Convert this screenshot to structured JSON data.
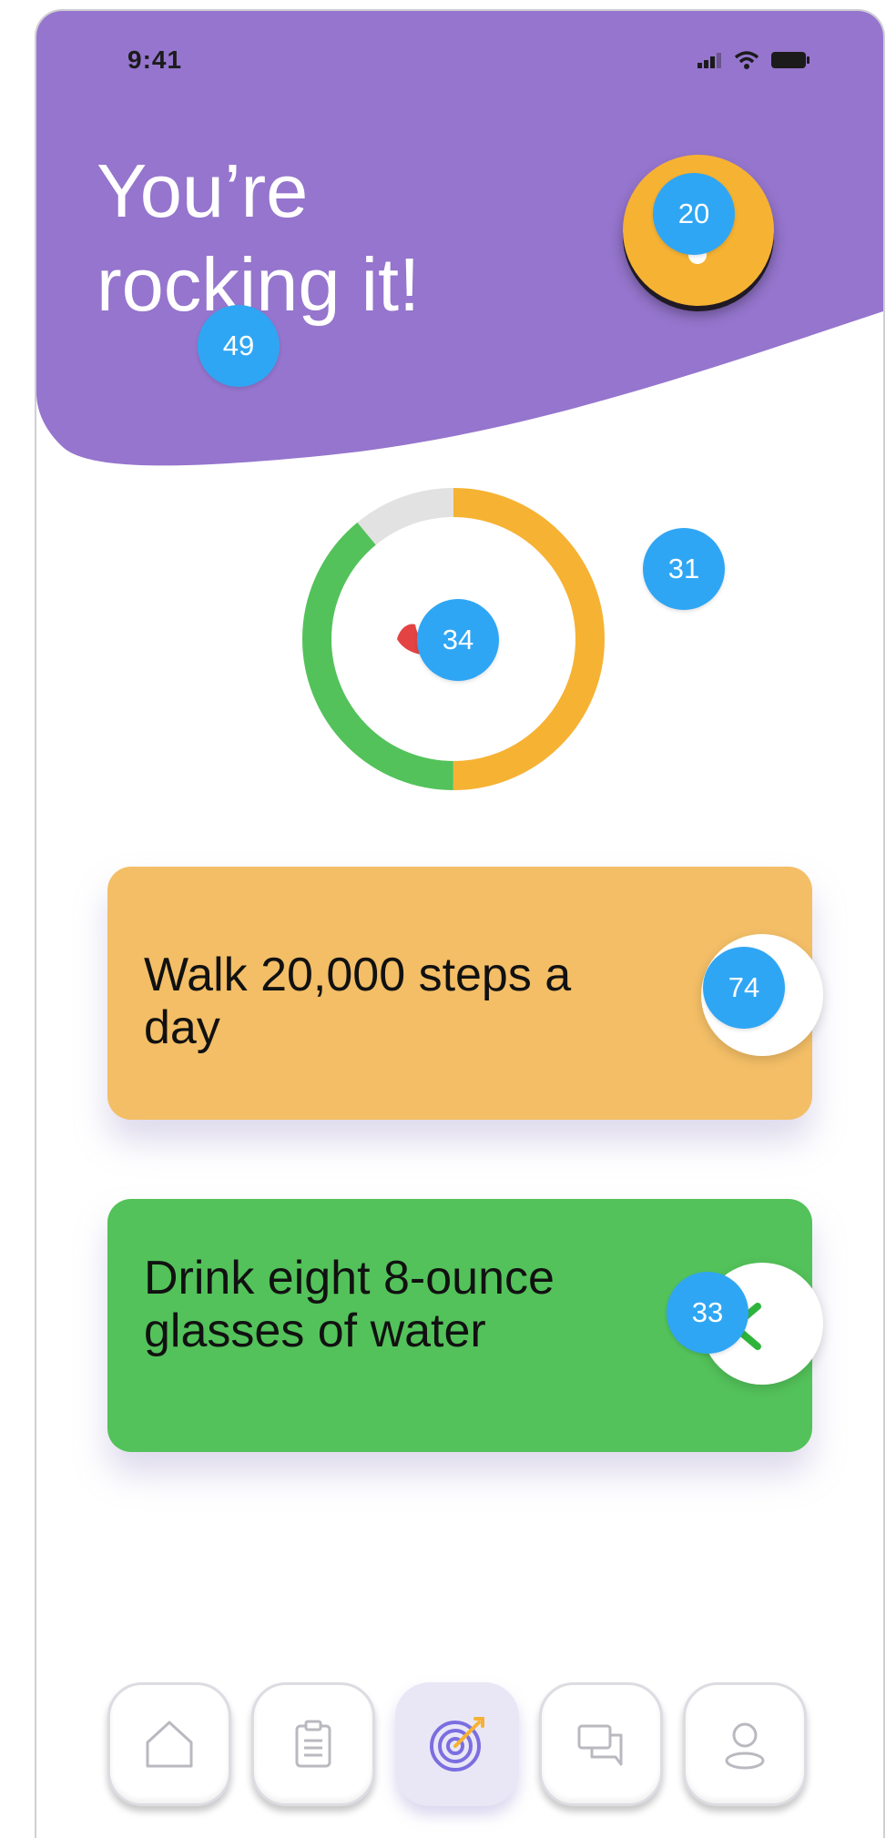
{
  "status_bar": {
    "time": "9:41"
  },
  "header": {
    "headline": "You’re rocking it!",
    "background_color": "#9575cd"
  },
  "avatar": {
    "color": "#f6b233"
  },
  "badges": {
    "avatar": "20",
    "headline": "49",
    "ring_side": "31",
    "ring_center": "34",
    "walk_toggle": "74",
    "water_toggle": "33"
  },
  "progress_ring": {
    "segments": [
      {
        "color": "#f6b233",
        "fraction": 0.5
      },
      {
        "color": "#53c25a",
        "fraction": 0.39
      },
      {
        "color": "#e2e2e2",
        "fraction": 0.11
      }
    ]
  },
  "goals": [
    {
      "label": "Walk 20,000 steps a day",
      "color": "#f3be66"
    },
    {
      "label": "Drink eight 8-ounce glasses of water",
      "color": "#53c25a",
      "completed": true
    }
  ],
  "nav": {
    "items": [
      {
        "icon": "home-icon"
      },
      {
        "icon": "clipboard-icon"
      },
      {
        "icon": "target-icon",
        "active": true
      },
      {
        "icon": "chat-icon"
      },
      {
        "icon": "profile-icon"
      }
    ],
    "accent_color": "#7b6ee0"
  }
}
